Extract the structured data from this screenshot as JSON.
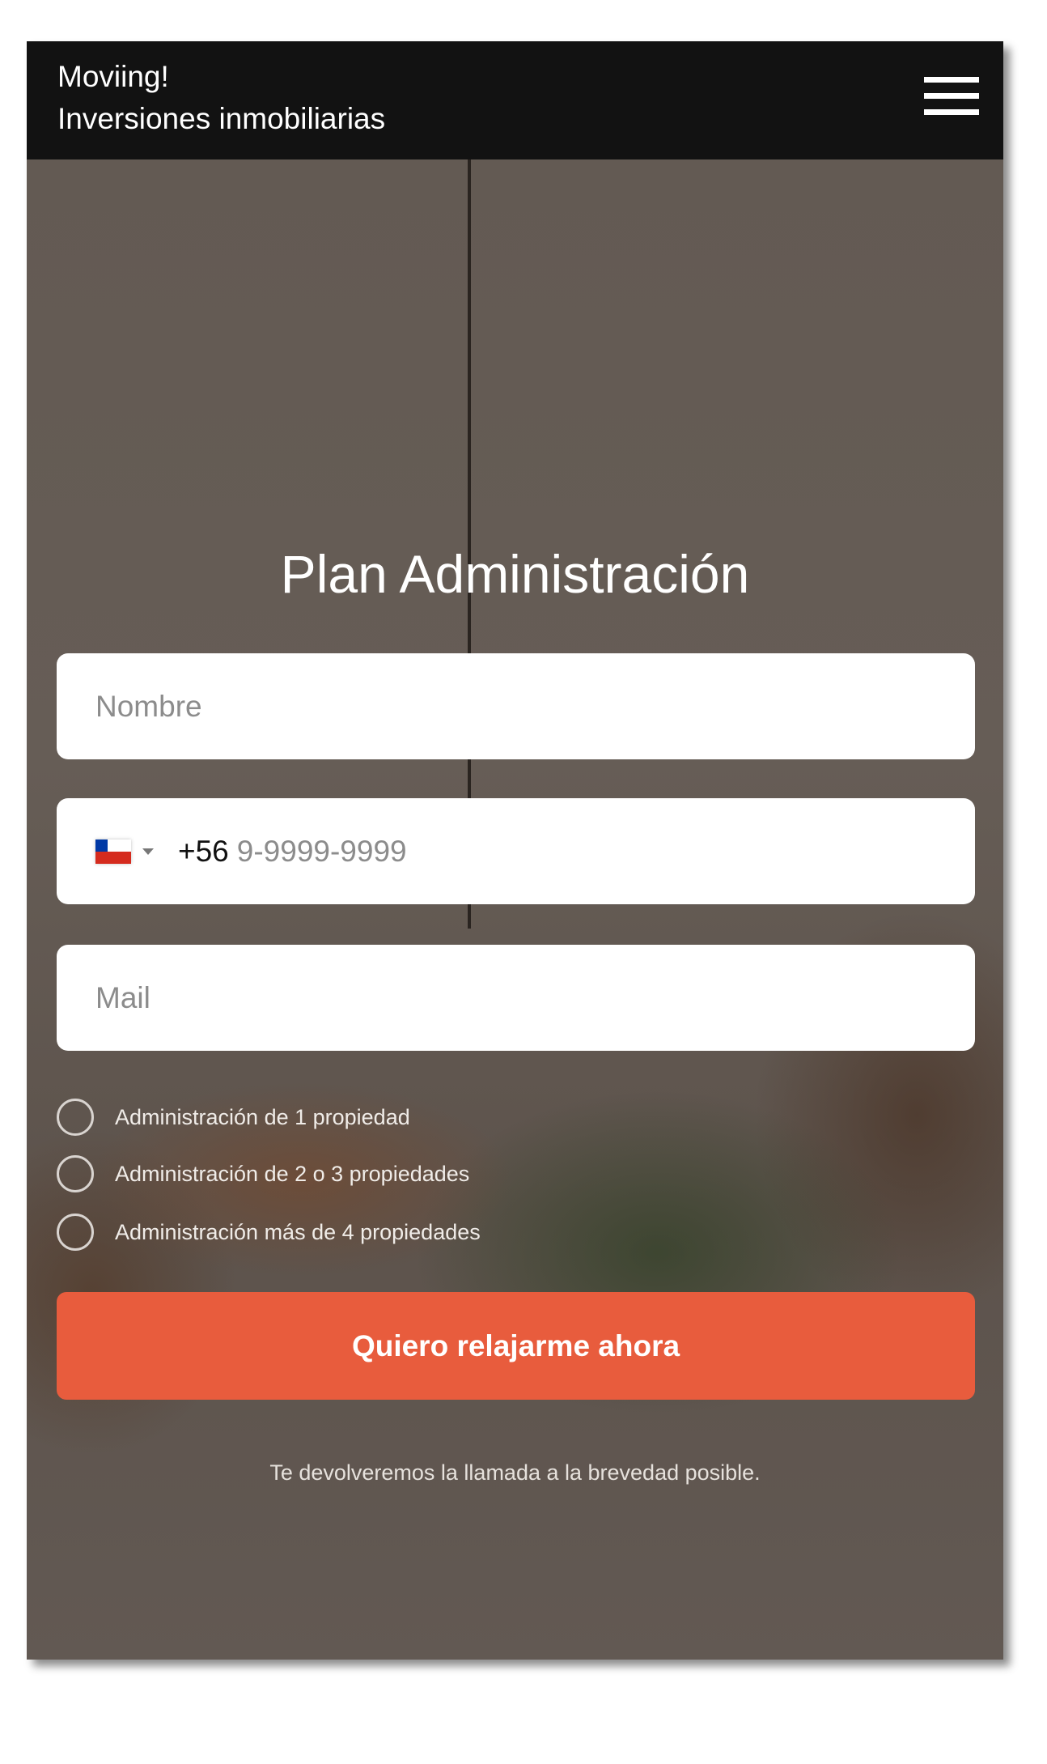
{
  "header": {
    "brand_line1": "Moviing!",
    "brand_line2": "Inversiones inmobiliarias",
    "menu_icon": "hamburger-icon"
  },
  "form": {
    "title": "Plan Administración",
    "name_placeholder": "Nombre",
    "phone": {
      "country_flag": "chile-flag-icon",
      "country_code": "+56",
      "placeholder": "9-9999-9999"
    },
    "mail_placeholder": "Mail",
    "options": [
      {
        "label": "Administración de 1 propiedad"
      },
      {
        "label": "Administración de 2 o 3 propiedades"
      },
      {
        "label": "Administración más de 4 propiedades"
      }
    ],
    "submit_label": "Quiero relajarme ahora",
    "note": "Te devolveremos la llamada a la brevedad posible."
  },
  "colors": {
    "header_bg": "#121212",
    "button": "#e85c3d"
  }
}
